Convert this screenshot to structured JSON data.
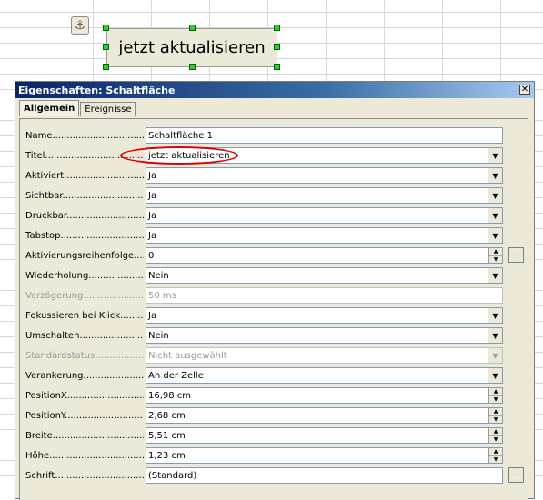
{
  "canvas": {
    "form_button_label": "jetzt aktualisieren",
    "anchor_icon": "anchor-icon"
  },
  "dialog": {
    "title": "Eigenschaften: Schaltfläche",
    "close_glyph": "✕",
    "tabs": [
      {
        "label": "Allgemein",
        "active": true
      },
      {
        "label": "Ereignisse",
        "active": false
      }
    ],
    "fields": [
      {
        "label": "Name.......................................",
        "value": "Schaltfläche 1",
        "control": "text",
        "disabled": false
      },
      {
        "label": "Titel.......................................",
        "value": "jetzt aktualisieren",
        "control": "dropdown",
        "disabled": false
      },
      {
        "label": "Aktiviert..................................",
        "value": "Ja",
        "control": "dropdown",
        "disabled": false
      },
      {
        "label": "Sichtbar..................................",
        "value": "Ja",
        "control": "dropdown",
        "disabled": false
      },
      {
        "label": "Druckbar.................................",
        "value": "Ja",
        "control": "dropdown",
        "disabled": false
      },
      {
        "label": "Tabstop....................................",
        "value": "Ja",
        "control": "dropdown",
        "disabled": false
      },
      {
        "label": "Aktivierungsreihenfolge.....",
        "value": "0",
        "control": "spin-ellipsis",
        "disabled": false
      },
      {
        "label": "Wiederholung......................",
        "value": "Nein",
        "control": "dropdown",
        "disabled": false
      },
      {
        "label": "Verzögerung........................",
        "value": "50 ms",
        "control": "text",
        "disabled": true
      },
      {
        "label": "Fokussieren bei Klick........",
        "value": "Ja",
        "control": "dropdown",
        "disabled": false
      },
      {
        "label": "Umschalten..........................",
        "value": "Nein",
        "control": "dropdown",
        "disabled": false
      },
      {
        "label": "Standardstatus...................",
        "value": "Nicht ausgewählt",
        "control": "dropdown",
        "disabled": true
      },
      {
        "label": "Verankerung.........................",
        "value": "An der Zelle",
        "control": "dropdown",
        "disabled": false
      },
      {
        "label": "PositionX..............................",
        "value": "16,98 cm",
        "control": "spin",
        "disabled": false
      },
      {
        "label": "PositionY..............................",
        "value": "2,68 cm",
        "control": "spin",
        "disabled": false
      },
      {
        "label": "Breite......................................",
        "value": "5,51 cm",
        "control": "spin",
        "disabled": false
      },
      {
        "label": "Höhe.......................................",
        "value": "1,23 cm",
        "control": "spin",
        "disabled": false
      },
      {
        "label": "Schrift.....................................",
        "value": "(Standard)",
        "control": "text-ellipsis",
        "disabled": false
      }
    ]
  }
}
